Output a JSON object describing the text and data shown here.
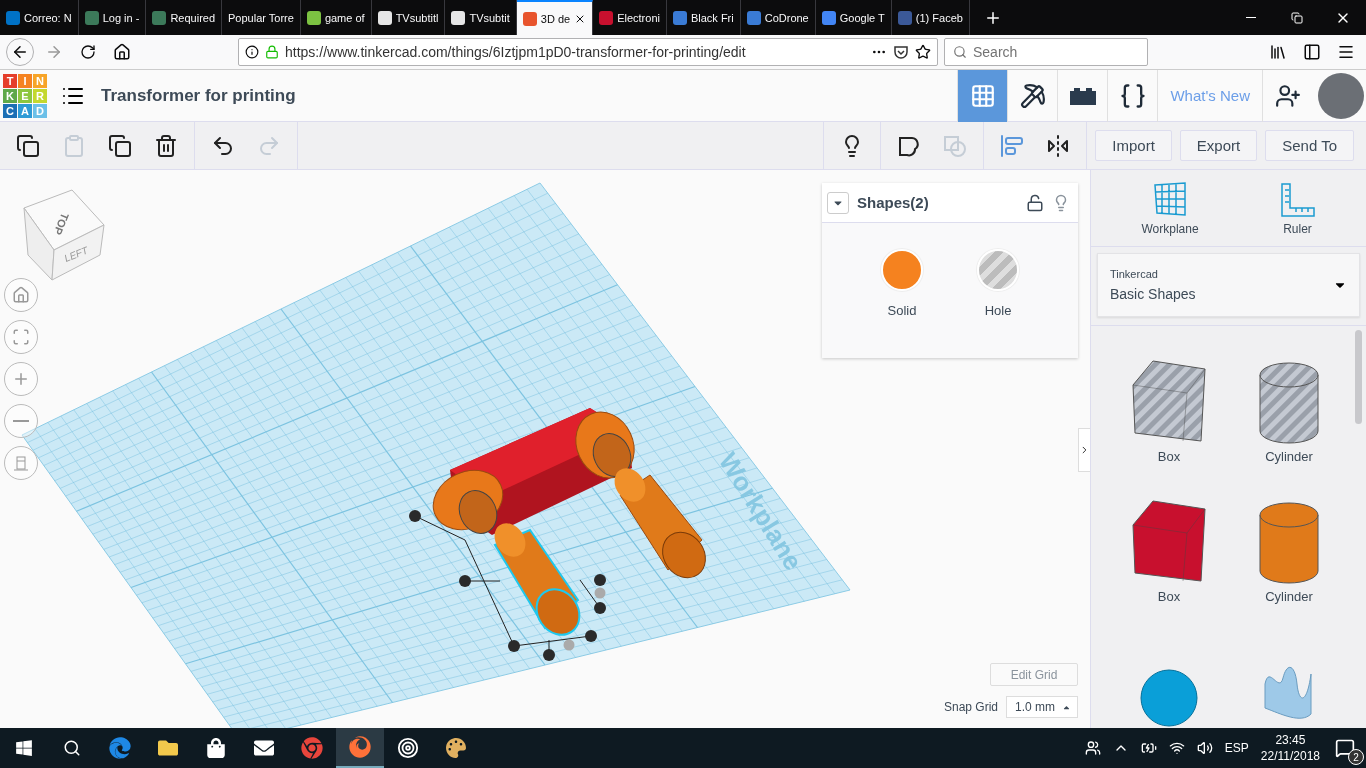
{
  "browser": {
    "tabs": [
      {
        "label": "Correo: N",
        "selected": false,
        "color": "#0072c6"
      },
      {
        "label": "Log in - ",
        "selected": false,
        "color": "#3c7a5a"
      },
      {
        "label": "Required",
        "selected": false,
        "color": "#3c7a5a"
      },
      {
        "label": "Popular Torre",
        "selected": false
      },
      {
        "label": "game of",
        "selected": false,
        "color": "#7cc242"
      },
      {
        "label": "TVsubtitl",
        "selected": false,
        "color": "#e6e6e6"
      },
      {
        "label": "TVsubtit",
        "selected": false,
        "color": "#e6e6e6"
      },
      {
        "label": "3D de",
        "selected": true,
        "color": "#e8542d"
      },
      {
        "label": "Electroni",
        "selected": false,
        "color": "#c8102e"
      },
      {
        "label": "Black Fri",
        "selected": false,
        "color": "#3a7bd5"
      },
      {
        "label": "CoDrone",
        "selected": false,
        "color": "#3a7bd5"
      },
      {
        "label": "Google T",
        "selected": false,
        "color": "#4285f4"
      },
      {
        "label": "(1) Faceb",
        "selected": false,
        "color": "#3b5998"
      }
    ],
    "url": "https://www.tinkercad.com/things/6Iztjpm1pD0-transformer-for-printing/edit",
    "search": {
      "placeholder": "Search"
    }
  },
  "app": {
    "logo": [
      {
        "letter": "T",
        "color": "#e53e2b"
      },
      {
        "letter": "I",
        "color": "#f58220"
      },
      {
        "letter": "N",
        "color": "#f7a428"
      },
      {
        "letter": "K",
        "color": "#5fa84a"
      },
      {
        "letter": "E",
        "color": "#8dc63f"
      },
      {
        "letter": "R",
        "color": "#c4d82e"
      },
      {
        "letter": "C",
        "color": "#1b6fb5"
      },
      {
        "letter": "A",
        "color": "#2e9bd6"
      },
      {
        "letter": "D",
        "color": "#6cc0e8"
      }
    ],
    "title": "Transformer for printing",
    "views": [
      {
        "kind": "grid",
        "selected": true
      },
      {
        "kind": "pickaxe",
        "selected": false
      },
      {
        "kind": "bricks",
        "selected": false
      },
      {
        "kind": "codeblocks",
        "selected": false
      }
    ],
    "whats_new": "What's New"
  },
  "toolbar": {
    "tools": [
      {
        "kind": "copy",
        "disabled": false
      },
      {
        "kind": "paste",
        "disabled": true
      },
      {
        "kind": "duplicate",
        "disabled": false
      },
      {
        "kind": "delete",
        "disabled": false
      },
      {
        "kind": "undo",
        "disabled": false
      },
      {
        "kind": "redo",
        "disabled": true
      },
      {
        "kind": "light",
        "disabled": false
      },
      {
        "kind": "note",
        "disabled": false
      },
      {
        "kind": "group",
        "disabled": true
      },
      {
        "kind": "align",
        "disabled": false
      },
      {
        "kind": "mirror",
        "disabled": false
      }
    ],
    "actions": [
      "Import",
      "Export",
      "Send To"
    ]
  },
  "canvas": {
    "view_cube": {
      "top": "TOP",
      "left": "LEFT"
    },
    "nav": [
      {
        "kind": "home"
      },
      {
        "kind": "fit"
      },
      {
        "kind": "zoom-in"
      },
      {
        "kind": "zoom-out"
      },
      {
        "kind": "perspective"
      }
    ],
    "workplane_label": "Workplane",
    "inspector": {
      "title": "Shapes(2)",
      "options": [
        {
          "kind": "solid",
          "label": "Solid"
        },
        {
          "kind": "hole",
          "label": "Hole"
        }
      ]
    },
    "edit_grid": "Edit Grid",
    "snap_grid": {
      "label": "Snap Grid",
      "value": "1.0 mm"
    }
  },
  "sidebar": {
    "tools": [
      {
        "kind": "workplane",
        "label": "Workplane"
      },
      {
        "kind": "ruler",
        "label": "Ruler"
      }
    ],
    "library": {
      "source": "Tinkercad",
      "category": "Basic Shapes"
    },
    "shapes": [
      {
        "kind": "box",
        "hole": true,
        "label": "Box"
      },
      {
        "kind": "cylinder",
        "hole": true,
        "label": "Cylinder"
      },
      {
        "kind": "box",
        "hole": false,
        "color": "#c8102e",
        "label": "Box"
      },
      {
        "kind": "cylinder",
        "hole": false,
        "color": "#e07a1a",
        "label": "Cylinder"
      },
      {
        "kind": "sphere",
        "hole": false,
        "color": "#0a9fd8"
      },
      {
        "kind": "scribble",
        "hole": false,
        "color": "#9ec9e8"
      }
    ]
  },
  "taskbar": {
    "apps": [
      {
        "kind": "start",
        "selected": false
      },
      {
        "kind": "search",
        "selected": false
      },
      {
        "kind": "edge",
        "selected": false
      },
      {
        "kind": "explorer",
        "selected": false
      },
      {
        "kind": "store",
        "selected": false
      },
      {
        "kind": "mail",
        "selected": false
      },
      {
        "kind": "chrome",
        "selected": false
      },
      {
        "kind": "firefox",
        "selected": true
      },
      {
        "kind": "target",
        "selected": false
      },
      {
        "kind": "paint",
        "selected": false
      }
    ],
    "language": "ESP",
    "time": "23:45",
    "date": "22/11/2018",
    "notifications": "2"
  }
}
